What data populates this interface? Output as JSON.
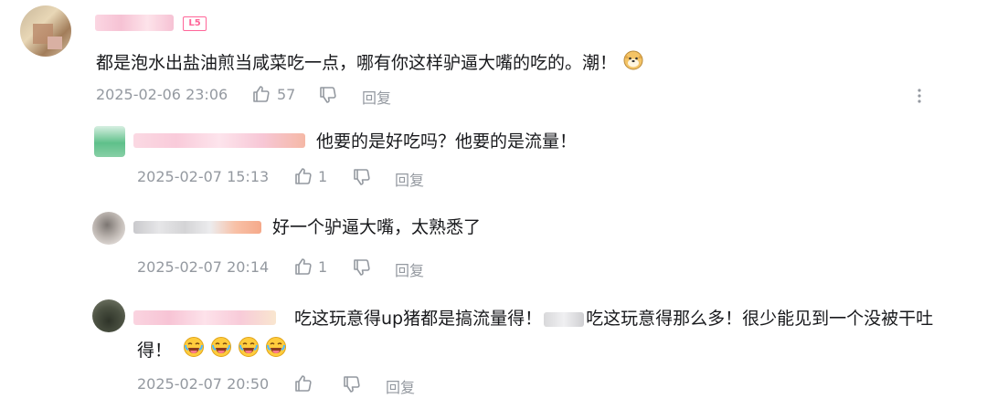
{
  "comments": [
    {
      "text": "都是泡水出盐油煎当咸菜吃一点，哪有你这样驴逼大嘴的吃的。潮！",
      "date": "2025-02-06 23:06",
      "likes": "57",
      "reply_label": "回复",
      "level": "L5"
    },
    {
      "text": "他要的是好吃吗？他要的是流量！",
      "date": "2025-02-07 15:13",
      "likes": "1",
      "reply_label": "回复"
    },
    {
      "text": "好一个驴逼大嘴，太熟悉了",
      "date": "2025-02-07 20:14",
      "likes": "1",
      "reply_label": "回复"
    },
    {
      "text_line1_a": "吃这玩意得up猪都是搞流量得！",
      "text_line1_b": "吃这玩意得那么多！很少能见到一个没被干吐",
      "text_line2": "得！",
      "date": "2025-02-07 20:50",
      "reply_label": "回复"
    }
  ],
  "colors": {
    "meta": "#9499a0",
    "text": "#18191c",
    "level": "#ff6699"
  },
  "icons": [
    "thumbs-up-icon",
    "thumbs-down-icon",
    "more-vertical-icon",
    "doge-emoji-icon",
    "laughing-emoji-icon"
  ]
}
